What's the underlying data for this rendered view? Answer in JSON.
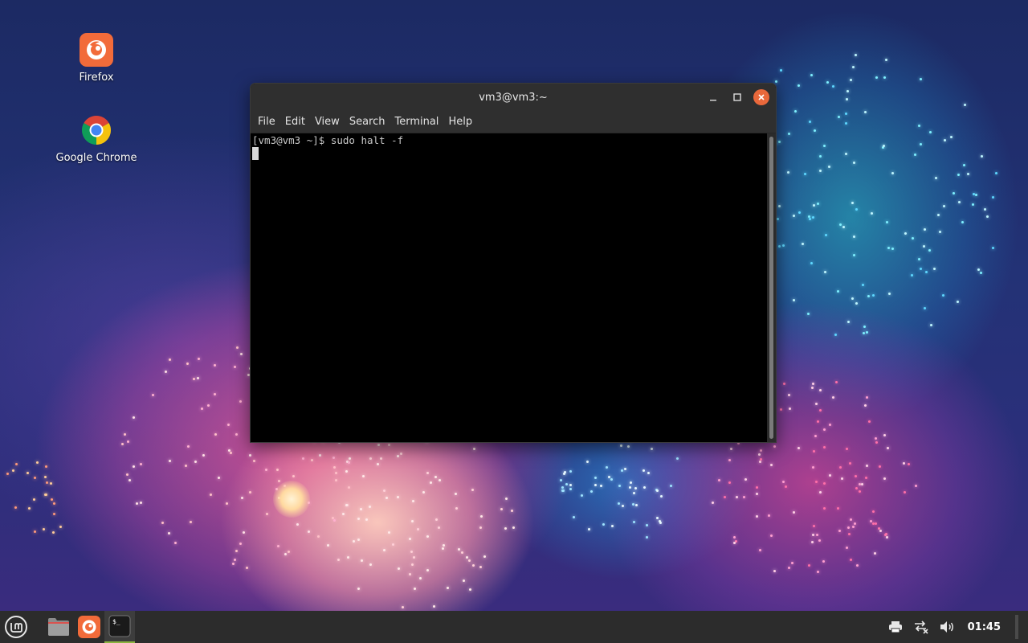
{
  "desktop": {
    "icons": [
      {
        "label": "Firefox",
        "icon": "firefox-icon"
      },
      {
        "label": "Google Chrome",
        "icon": "chrome-icon"
      }
    ]
  },
  "terminal": {
    "title": "vm3@vm3:~",
    "menu": [
      "File",
      "Edit",
      "View",
      "Search",
      "Terminal",
      "Help"
    ],
    "lines": [
      "[vm3@vm3 ~]$ sudo halt -f"
    ],
    "controls": {
      "minimize": "minimize-icon",
      "maximize": "maximize-icon",
      "close": "close-icon"
    }
  },
  "panel": {
    "menu_icon": "linux-mint-menu-icon",
    "tasks": [
      {
        "icon": "file-manager-icon"
      },
      {
        "icon": "firefox-icon"
      },
      {
        "icon": "terminal-icon"
      }
    ],
    "tray": {
      "printer_icon": "printer-icon",
      "network_icon": "network-disconnected-icon",
      "volume_icon": "volume-icon",
      "clock": "01:45"
    }
  },
  "colors": {
    "accent_orange": "#e9683b",
    "panel_bg": "#2c2c2c",
    "terminal_bg": "#000000",
    "titlebar_bg": "#2f2f2f",
    "active_indicator": "#8ab33f"
  }
}
